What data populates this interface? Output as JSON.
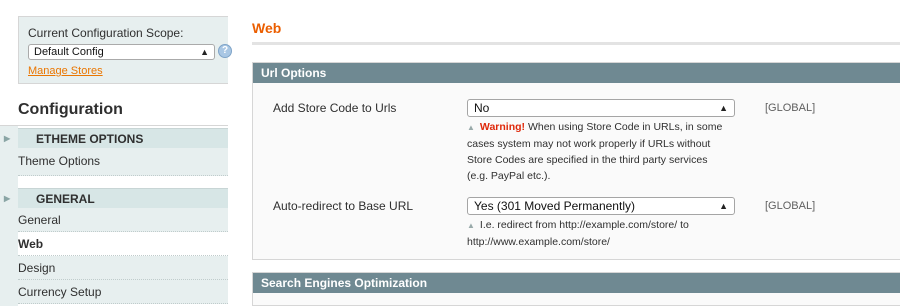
{
  "sidebar": {
    "scope_label": "Current Configuration Scope:",
    "scope_value": "Default Config",
    "help_icon": "?",
    "manage_stores": "Manage Stores",
    "config_title": "Configuration",
    "groups": [
      {
        "header": "ETHEME OPTIONS",
        "items": [
          {
            "label": "Theme Options"
          }
        ]
      },
      {
        "header": "GENERAL",
        "items": [
          {
            "label": "General"
          },
          {
            "label": "Web"
          },
          {
            "label": "Design"
          },
          {
            "label": "Currency Setup"
          }
        ]
      }
    ],
    "active_item": "Web"
  },
  "main": {
    "title": "Web",
    "sections": [
      {
        "title": "Url Options",
        "rows": [
          {
            "label": "Add Store Code to Urls",
            "value": "No",
            "scope": "[GLOBAL]",
            "note_warning": "Warning!",
            "note_lines": [
              "When using Store Code in URLs, in some",
              "cases system may not work properly if URLs without",
              "Store Codes are specified in the third party services",
              "(e.g. PayPal etc.)."
            ]
          },
          {
            "label": "Auto-redirect to Base URL",
            "value": "Yes (301 Moved Permanently)",
            "scope": "[GLOBAL]",
            "note_lines": [
              "I.e. redirect from http://example.com/store/ to",
              "http://www.example.com/store/"
            ]
          }
        ]
      },
      {
        "title": "Search Engines Optimization"
      }
    ]
  },
  "colors": {
    "accent_orange": "#eb5e00",
    "section_header": "#6f8992",
    "sidebar_bg": "#e7efef",
    "warning_red": "#df280a"
  },
  "icons": {
    "select_arrows": "select-arrows-icon",
    "help": "help-icon",
    "note_pointer": "note-pointer-icon",
    "group_toggle": "triangle-right-icon"
  }
}
